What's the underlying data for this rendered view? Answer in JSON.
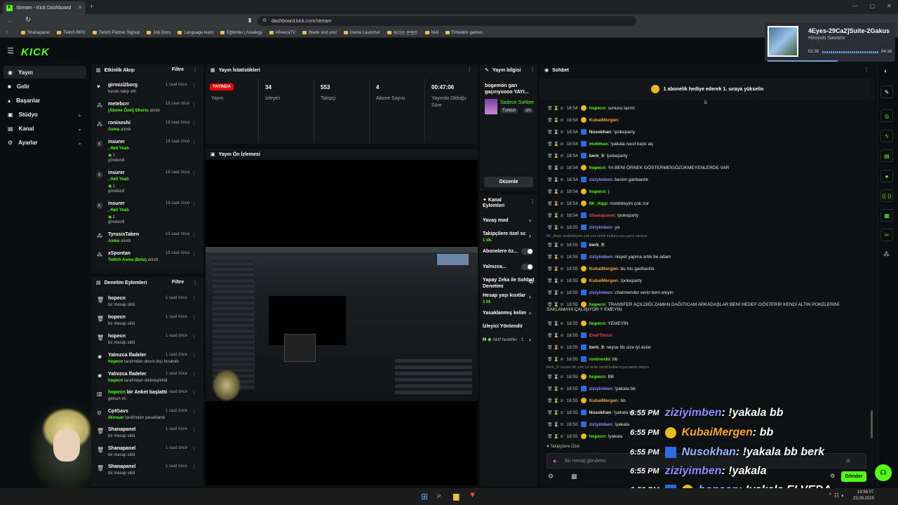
{
  "browser": {
    "tab_title": "Stream - Kick Dashboard",
    "url": "dashboard.kick.com/stream",
    "bookmarks": [
      "Shanapanel",
      "Twitch RPG",
      "Twitch Partner Signup",
      "Job Docs",
      "Language learn",
      "Eğitimler | Asialogy",
      "AfreecaTV",
      "Blade and soul",
      "Game Launcher",
      "바디오 콘텐츠",
      "Null",
      "Emulator games"
    ]
  },
  "media": {
    "title": "4Eyes-29Ca2]Suite-2Gakus",
    "artist": "Hiroyuki Sawano",
    "elapsed": "02:28",
    "total": "04:18"
  },
  "sidebar": {
    "logo": "KICK",
    "items": [
      {
        "label": "Yayın"
      },
      {
        "label": "Gelir"
      },
      {
        "label": "Başarılar"
      },
      {
        "label": "Stüdyo"
      },
      {
        "label": "Kanal"
      },
      {
        "label": "Ayarlar"
      }
    ]
  },
  "activity": {
    "title": "Etkinlik Akışı",
    "filter": "Filtre",
    "events": [
      {
        "name": "girmizi2borg",
        "sub": "kanalı takip etti",
        "time": "1 saat önce"
      },
      {
        "name": "metebcrr",
        "sub_hl": "(Abone Özel) Shorts",
        "sub": " alındı",
        "time": "18 saat önce"
      },
      {
        "name": "roninoshi",
        "sub_hl": "Asma",
        "sub": " alındı",
        "time": "18 saat önce"
      },
      {
        "name": "insurer",
        "sub_hl": ", Heli Yeah",
        "sub2": "1",
        "sub3": "gönderdi",
        "time": "18 saat önce"
      },
      {
        "name": "insurer",
        "sub_hl": ", Heli Yeah",
        "sub2": "1",
        "sub3": "gönderdi",
        "time": "18 saat önce"
      },
      {
        "name": "insurer",
        "sub_hl": ", Heli Yeah",
        "sub2": "1",
        "sub3": "gönderdi",
        "time": "19 saat önce"
      },
      {
        "name": "TyrusisTaken",
        "sub_hl": "Asma",
        "sub": " alındı",
        "time": "19 saat önce"
      },
      {
        "name": "xSpontan",
        "sub_hl": "Twitch Asma (Beta)",
        "sub": " alındı",
        "time": "19 saat önce"
      }
    ]
  },
  "moderation": {
    "title": "Denetim Eylemleri",
    "filter": "Filtre",
    "events": [
      {
        "name": "hopecn",
        "sub": "bir mesajı sildi",
        "time": "1 saat önce"
      },
      {
        "name": "hopecn",
        "sub": "bir mesajı sildi",
        "time": "1 saat önce"
      },
      {
        "name": "hopecn",
        "sub": "bir mesajı sildi",
        "time": "1 saat önce"
      },
      {
        "name": "Yalnızca İfadeler",
        "sub_hl": "hopecn",
        "sub": " tarafından devre dışı bırakıldı",
        "time": "1 saat önce"
      },
      {
        "name": "Yalnızca İfadeler",
        "sub_hl": "hopecn",
        "sub": " tarafından etkinleştirildi",
        "time": "1 saat önce"
      },
      {
        "name_hl": "hopecn",
        "name": " bir Anket başlattı",
        "sub": "gelsun mi",
        "time": "1 saat önce"
      },
      {
        "name": "CptGavs",
        "sub_hl": "ilkinsan",
        "sub": " tarafından yasaklandı",
        "time": "1 saat önce"
      },
      {
        "name": "Shanapanel",
        "sub": "bir mesajı sildi",
        "time": "1 saat önce"
      },
      {
        "name": "Shanapanel",
        "sub": "bir mesajı sildi",
        "time": "1 saat önce"
      },
      {
        "name": "Shanapanel",
        "sub": "bir mesajı sildi",
        "time": "1 saat önce"
      }
    ]
  },
  "stats": {
    "title": "Yayın İstatistikleri",
    "live_badge": "YAYINDA",
    "items": [
      {
        "value": "",
        "label": "Yayın"
      },
      {
        "value": "34",
        "label": "İzleyici"
      },
      {
        "value": "553",
        "label": "Takipçi"
      },
      {
        "value": "4",
        "label": "Abone Sayısı"
      },
      {
        "value": "00:47:06",
        "label": "Yayında Olduğu Süre"
      }
    ]
  },
  "preview": {
    "title": "Yayın Ön İzlemesi"
  },
  "streaminfo": {
    "title": "Yayın bilgisi",
    "stream_title": "bogemon garı gaçırıyoooo YAYI...",
    "category": "Sadece Sohbet",
    "tags": [
      "Turkish",
      "shi"
    ],
    "edit": "Düzenle"
  },
  "actions": {
    "title": "Kanal Eylemleri",
    "items": [
      {
        "label": "Yavaş mod"
      },
      {
        "label": "Takipçilere özel sc",
        "sub": "1 dk."
      },
      {
        "label": "Abonelere öz..."
      },
      {
        "label": "Yalnızca..."
      },
      {
        "label": "Yapay Zeka ile Sohbet Denetimi"
      },
      {
        "label": "Hesap yaşı kısıtlar",
        "sub": "1 hf."
      },
      {
        "label": "Yasaklanmış kelim"
      },
      {
        "label": "İzleyici Yönlendir"
      },
      {
        "label": "H",
        "sub": "Aktif hedefler · 1"
      }
    ]
  },
  "chat": {
    "title": "Sohbet",
    "banner": "1 abonelik hediye ederek 1. sıraya yükselin",
    "messages": [
      {
        "time": "18:54",
        "user": "hopecn",
        "color": "#53fc18",
        "text": ": sunucu lazım"
      },
      {
        "time": "18:54",
        "user": "KubaiMergen",
        "color": "#f4a63a",
        "text": ": "
      },
      {
        "time": "18:54",
        "user": "Nusokhan",
        "color": "#e6e6e6",
        "text": ": !pokeparty"
      },
      {
        "time": "18:54",
        "user": "mutimax",
        "color": "#53fc18",
        "text": ": !yakala nasıl kaçtı aq"
      },
      {
        "time": "18:54",
        "user": "berk_9",
        "color": "#e6e6e6",
        "text": ": !pokeparty"
      },
      {
        "time": "18:54",
        "user": "hopecn",
        "color": "#53fc18",
        "text": ": YA BENİ ÖRNEK GÖSTERMEİGÖZÜKMEYENLERDE VAR"
      },
      {
        "time": "18:54",
        "user": "ziziyimben",
        "color": "#8f8cff",
        "text": ": benim garibanlık"
      },
      {
        "time": "18:54",
        "user": "hopecn",
        "color": "#53fc18",
        "text": ": )"
      },
      {
        "time": "18:54",
        "user": "Mr_Aipp",
        "color": "#53fc18",
        "text": ": mobildeyim çok zor"
      },
      {
        "time": "18:54",
        "user": "Shanapanel",
        "color": "#e04848",
        "text": ": !pokeparty"
      },
      {
        "time": "18:55",
        "user": "ziziyimben",
        "color": "#8f8cff",
        "text": ": ya"
      },
      {
        "time": "18:55",
        "user": "berk_9",
        "color": "#e6e6e6",
        "text": ": "
      },
      {
        "time": "18:55",
        "user": "ziziyimben",
        "color": "#8f8cff",
        "text": ": nispet yapma artık be adam"
      },
      {
        "time": "18:55",
        "user": "KubaiMergen",
        "color": "#f4a63a",
        "text": ": bu mu garibanlık"
      },
      {
        "time": "18:55",
        "user": "KubaiMergen",
        "color": "#f4a63a",
        "text": ": !pokeparty"
      },
      {
        "time": "18:55",
        "user": "ziziyimben",
        "color": "#8f8cff",
        "text": ": charmender verin beni eleyin"
      },
      {
        "time": "18:55",
        "user": "hopecn",
        "color": "#53fc18",
        "text": ": TRANSFER AÇILDIĞI ZAMAN DAĞITICAM ARKADAŞLAR BENİ HEDEF GÖSTERİP KENDİ ALTIN POKELERİNİ"
      },
      {
        "time": "18:55",
        "user": "hopecn",
        "color": "#53fc18",
        "text": ": YEMEYİN"
      },
      {
        "time": "18:55",
        "user": "EmirTimur",
        "color": "#e04848",
        "text": ": "
      },
      {
        "time": "18:55",
        "user": "berk_9",
        "color": "#e6e6e6",
        "text": ": neyse bb size iyi avlar"
      },
      {
        "time": "18:55",
        "user": "roninoshi",
        "color": "#53fc18",
        "text": ": bb"
      },
      {
        "time": "18:55",
        "user": "hopecn",
        "color": "#53fc18",
        "text": ": BB"
      },
      {
        "time": "18:55",
        "user": "ziziyimben",
        "color": "#8f8cff",
        "text": ": !yakala bb"
      },
      {
        "time": "18:55",
        "user": "KubaiMergen",
        "color": "#f4a63a",
        "text": ": bb"
      },
      {
        "time": "18:55",
        "user": "Nusokhan",
        "color": "#e6e6e6",
        "text": ": !yakala bb"
      },
      {
        "time": "18:55",
        "user": "ziziyimben",
        "color": "#8f8cff",
        "text": ": !yakala"
      },
      {
        "time": "18:55",
        "user": "hopecn",
        "color": "#53fc18",
        "text": ": !yakala"
      }
    ],
    "wrap_line": "SAKLAMAYA ÇALIŞIYOR Y EMEYİN",
    "reply1": "Mr_Aipp: mobildeyim çok zor isimli kullanıcıya yanıt veriyor",
    "reply2": "berk_9: neyse bb size iyi avlar isimli kullanıcıya yanıt veriyor",
    "followers_only": "Takipçilere Özel",
    "placeholder": "Bir mesaj gönderin",
    "send": "Gönder"
  },
  "overlay": {
    "lines": [
      {
        "time": "6:55 PM",
        "user": "ziziyimben",
        "color": "#8f8cff",
        "msg": ": !yakala bb"
      },
      {
        "time": "6:55 PM",
        "user": "KubaiMergen",
        "color": "#f4a63a",
        "msg": ": bb"
      },
      {
        "time": "6:55 PM",
        "user": "Nusokhan",
        "color": "#8fb8ff",
        "msg": ": !yakala bb berk"
      },
      {
        "time": "6:55 PM",
        "user": "ziziyimben",
        "color": "#8f8cff",
        "msg": ": !yakala"
      },
      {
        "time": "6:56 PM",
        "user": "hopecn",
        "color": "#8fb8ff",
        "msg": ": !yakala ELVEDA"
      }
    ]
  },
  "taskbar": {
    "clock": "18:56:07",
    "date": "23.09.2025"
  }
}
